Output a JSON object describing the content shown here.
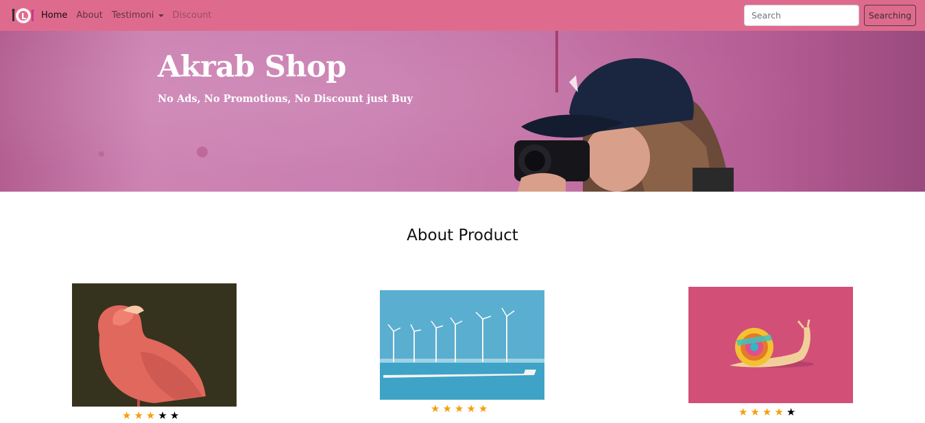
{
  "navbar": {
    "brand_logo": "logo-icon",
    "links": [
      {
        "label": "Home",
        "state": "active"
      },
      {
        "label": "About",
        "state": "normal"
      },
      {
        "label": "Testimoni",
        "state": "dropdown"
      },
      {
        "label": "Discount",
        "state": "disabled"
      }
    ],
    "search": {
      "placeholder": "Search",
      "value": ""
    },
    "search_button_label": "Searching",
    "background_color": "#de6b8e"
  },
  "hero": {
    "title": "Akrab Shop",
    "subtitle": "No Ads, No Promotions, No Discount just Buy",
    "background_color": "#c97fb1"
  },
  "section": {
    "title": "About Product"
  },
  "products": [
    {
      "image": "flamingo-image",
      "rating": 3,
      "max_rating": 5
    },
    {
      "image": "wind-turbines-image",
      "rating": 5,
      "max_rating": 5
    },
    {
      "image": "snail-image",
      "rating": 4,
      "max_rating": 5
    }
  ],
  "colors": {
    "star_filled": "#f59f0b",
    "star_empty": "#000000"
  }
}
